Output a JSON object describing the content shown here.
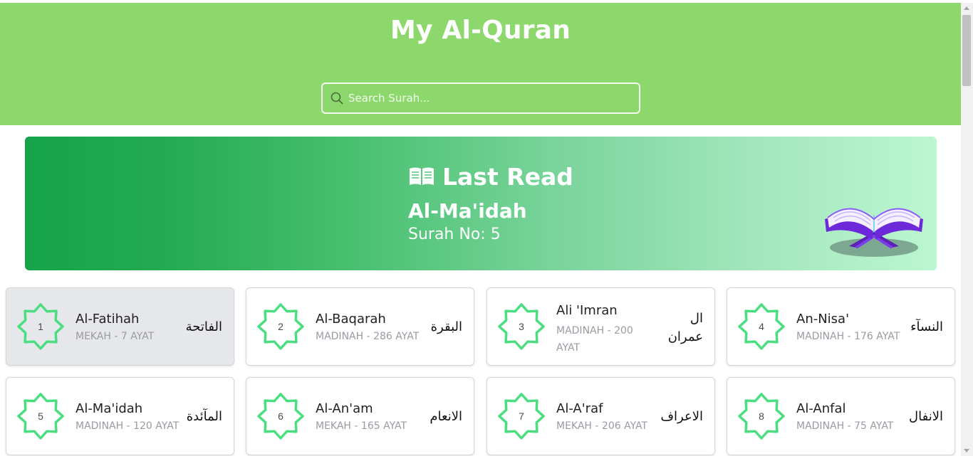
{
  "app": {
    "title": "My Al-Quran"
  },
  "search": {
    "placeholder": "Search Surah...",
    "value": ""
  },
  "last_read": {
    "heading": "Last Read",
    "surah_name": "Al-Ma'idah",
    "surah_number_text": "Surah No: 5"
  },
  "colors": {
    "header": "#8cd86c",
    "accent_green": "#4ade80",
    "banner_start": "#16a34a",
    "banner_end": "#bbf7d0"
  },
  "surahs": [
    {
      "number": "1",
      "name": "Al-Fatihah",
      "meta": "MEKAH - 7 AYAT",
      "arabic": "الفاتحة",
      "active": true
    },
    {
      "number": "2",
      "name": "Al-Baqarah",
      "meta": "MADINAH - 286 AYAT",
      "arabic": "البقرة"
    },
    {
      "number": "3",
      "name": "Ali 'Imran",
      "meta": "MADINAH - 200 AYAT",
      "arabic": "ال عمران"
    },
    {
      "number": "4",
      "name": "An-Nisa'",
      "meta": "MADINAH - 176 AYAT",
      "arabic": "النسآء"
    },
    {
      "number": "5",
      "name": "Al-Ma'idah",
      "meta": "MADINAH - 120 AYAT",
      "arabic": "المآئدة"
    },
    {
      "number": "6",
      "name": "Al-An'am",
      "meta": "MEKAH - 165 AYAT",
      "arabic": "الانعام"
    },
    {
      "number": "7",
      "name": "Al-A'raf",
      "meta": "MEKAH - 206 AYAT",
      "arabic": "الاعراف"
    },
    {
      "number": "8",
      "name": "Al-Anfal",
      "meta": "MADINAH - 75 AYAT",
      "arabic": "الانفال"
    }
  ]
}
